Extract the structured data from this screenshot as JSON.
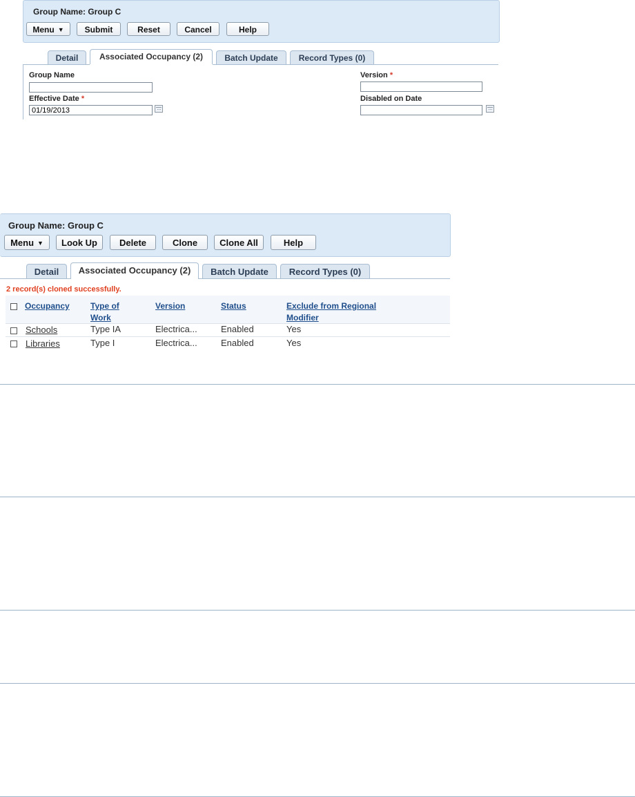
{
  "panel1": {
    "title": "Group Name: Group C",
    "buttons": {
      "menu": "Menu",
      "submit": "Submit",
      "reset": "Reset",
      "cancel": "Cancel",
      "help": "Help"
    },
    "tabs": [
      "Detail",
      "Associated Occupancy (2)",
      "Batch Update",
      "Record Types (0)"
    ],
    "active_tab": "Associated Occupancy (2)",
    "form": {
      "group_name_label": "Group Name",
      "group_name_value": "",
      "effective_date_label": "Effective Date",
      "effective_date_value": "01/19/2013",
      "version_label": "Version",
      "version_value": "",
      "disabled_on_label": "Disabled on Date",
      "disabled_on_value": "",
      "required_mark": "*"
    }
  },
  "panel2": {
    "title": "Group Name: Group C",
    "buttons": {
      "menu": "Menu",
      "lookup": "Look Up",
      "delete": "Delete",
      "clone": "Clone",
      "clone_all": "Clone All",
      "help": "Help"
    },
    "tabs": [
      "Detail",
      "Associated Occupancy (2)",
      "Batch Update",
      "Record Types (0)"
    ],
    "active_tab": "Associated Occupancy (2)",
    "message": "2 record(s) cloned successfully.",
    "table": {
      "columns": [
        "Occupancy",
        "Type of Work",
        "Version",
        "Status",
        "Exclude from Regional Modifier"
      ],
      "column_lines": {
        "type_of_work": [
          "Type of",
          "Work"
        ],
        "exclude": [
          "Exclude from Regional",
          "Modifier"
        ]
      },
      "rows": [
        {
          "occupancy": "Schools",
          "type_of_work": "Type IA",
          "version": "Electrica...",
          "status": "Enabled",
          "exclude": "Yes"
        },
        {
          "occupancy": "Libraries",
          "type_of_work": "Type I",
          "version": "Electrica...",
          "status": "Enabled",
          "exclude": "Yes"
        }
      ]
    }
  },
  "colors": {
    "header_bg": "#dce9f6",
    "link": "#1f4e8c",
    "success_message": "#e04020",
    "required": "#d43a2a"
  }
}
